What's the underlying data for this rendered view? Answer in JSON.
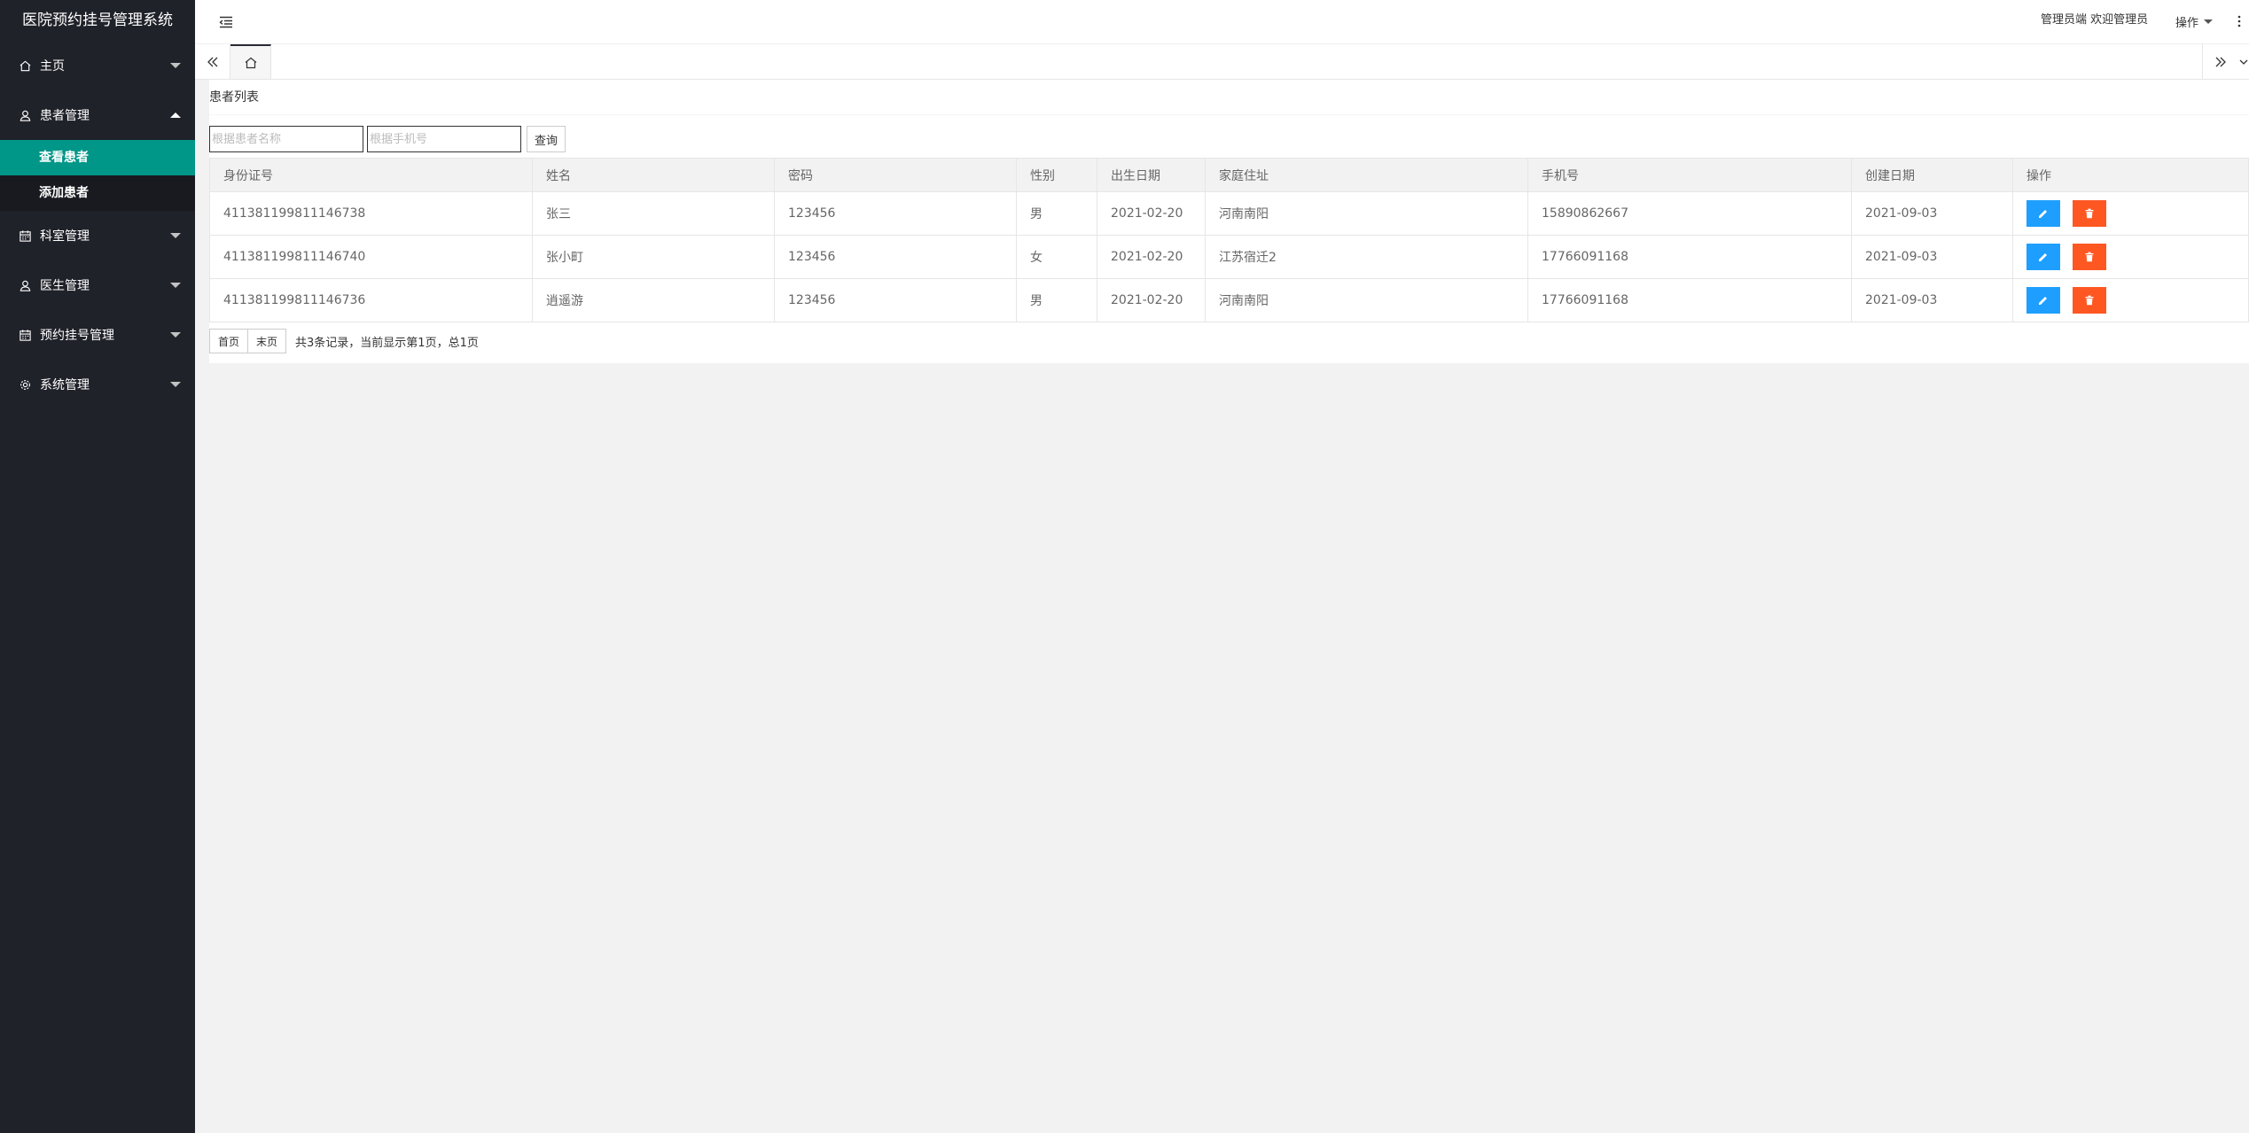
{
  "app": {
    "title": "医院预约挂号管理系统"
  },
  "header": {
    "user_text": "管理员端 欢迎管理员",
    "ops_label": "操作"
  },
  "sidebar": {
    "items": [
      {
        "label": "主页",
        "icon": "home-icon"
      },
      {
        "label": "患者管理",
        "icon": "user-icon",
        "expanded": true,
        "children": [
          {
            "label": "查看患者",
            "active": true
          },
          {
            "label": "添加患者"
          }
        ]
      },
      {
        "label": "科室管理",
        "icon": "calendar-icon"
      },
      {
        "label": "医生管理",
        "icon": "user-icon"
      },
      {
        "label": "预约挂号管理",
        "icon": "calendar-icon"
      },
      {
        "label": "系统管理",
        "icon": "gear-icon"
      }
    ]
  },
  "content": {
    "title": "患者列表",
    "search": {
      "name_placeholder": "根据患者名称",
      "phone_placeholder": "根据手机号",
      "query_label": "查询"
    },
    "table": {
      "headers": [
        "身份证号",
        "姓名",
        "密码",
        "性别",
        "出生日期",
        "家庭住址",
        "手机号",
        "创建日期",
        "操作"
      ],
      "rows": [
        [
          "411381199811146738",
          "张三",
          "123456",
          "男",
          "2021-02-20",
          "河南南阳",
          "15890862667",
          "2021-09-03"
        ],
        [
          "411381199811146740",
          "张小町",
          "123456",
          "女",
          "2021-02-20",
          "江苏宿迁2",
          "17766091168",
          "2021-09-03"
        ],
        [
          "411381199811146736",
          "逍遥游",
          "123456",
          "男",
          "2021-02-20",
          "河南南阳",
          "17766091168",
          "2021-09-03"
        ]
      ]
    },
    "pager": {
      "first_label": "首页",
      "last_label": "末页",
      "summary": "共3条记录，当前显示第1页，总1页"
    }
  },
  "colors": {
    "sidebar_bg": "#20222a",
    "active": "#009688",
    "edit": "#1e9fff",
    "delete": "#ff5722"
  }
}
